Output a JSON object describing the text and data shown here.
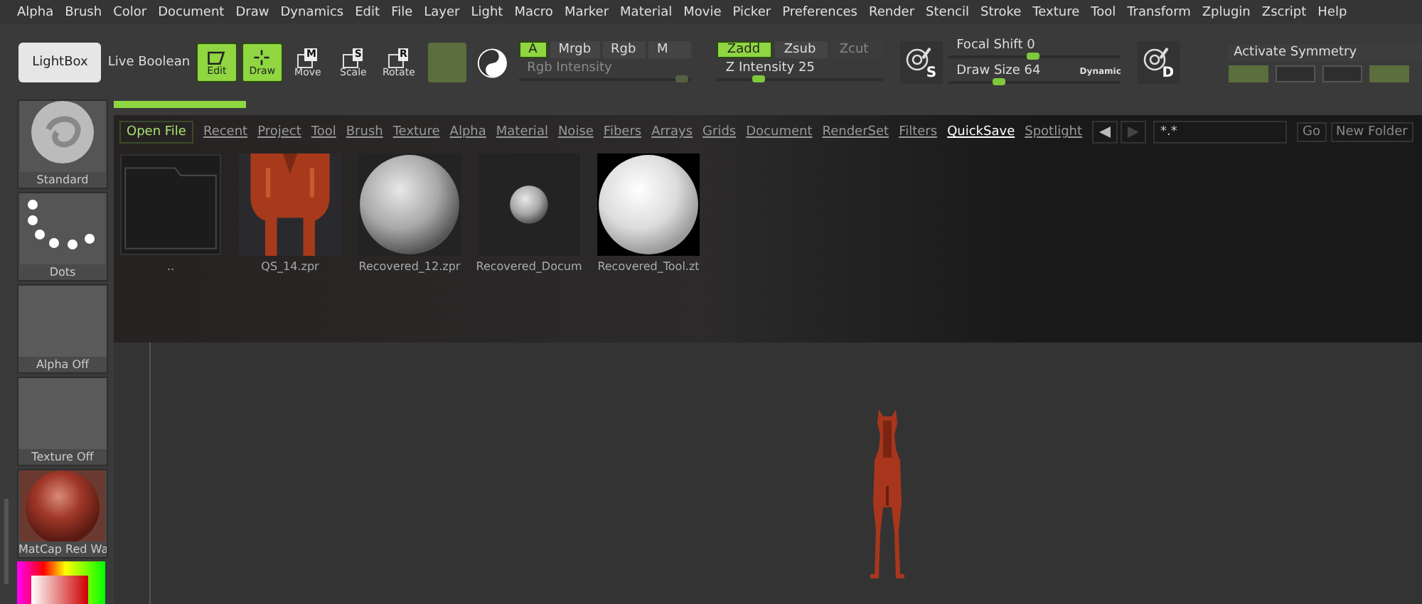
{
  "menu": [
    "Alpha",
    "Brush",
    "Color",
    "Document",
    "Draw",
    "Dynamics",
    "Edit",
    "File",
    "Layer",
    "Light",
    "Macro",
    "Marker",
    "Material",
    "Movie",
    "Picker",
    "Preferences",
    "Render",
    "Stencil",
    "Stroke",
    "Texture",
    "Tool",
    "Transform",
    "Zplugin",
    "Zscript",
    "Help"
  ],
  "toolbar": {
    "lightbox": "LightBox",
    "live_boolean": "Live Boolean",
    "tools": [
      {
        "label": "Edit",
        "kind": "edit",
        "selected": true
      },
      {
        "label": "Draw",
        "kind": "draw",
        "selected": true
      },
      {
        "label": "Move",
        "kind": "move",
        "key": "M",
        "selected": false
      },
      {
        "label": "Scale",
        "kind": "scale",
        "key": "S",
        "selected": false
      },
      {
        "label": "Rotate",
        "kind": "rotate",
        "key": "R",
        "selected": false
      }
    ],
    "color_modes": [
      {
        "label": "A",
        "selected": true
      },
      {
        "label": "Mrgb",
        "selected": false
      },
      {
        "label": "Rgb",
        "selected": false
      },
      {
        "label": "M",
        "selected": false
      }
    ],
    "rgb_intensity": {
      "label": "Rgb Intensity",
      "disabled": true,
      "level": 0.95
    },
    "z_modes": [
      {
        "label": "Zadd",
        "selected": true,
        "disabled": false
      },
      {
        "label": "Zsub",
        "selected": false,
        "disabled": false
      },
      {
        "label": "Zcut",
        "selected": false,
        "disabled": true
      }
    ],
    "z_intensity": {
      "label": "Z Intensity 25",
      "level": 0.25
    },
    "stroke_key": "S",
    "focal_shift": {
      "label": "Focal Shift 0",
      "level": 0.5
    },
    "draw_size": {
      "label": "Draw Size 64",
      "level": 0.3
    },
    "dynamic": "Dynamic",
    "alpha_key": "D",
    "symmetry": {
      "label": "Activate Symmetry"
    }
  },
  "progress": {
    "level": 1
  },
  "palette": [
    {
      "label": "Standard",
      "kind": "brush"
    },
    {
      "label": "Dots",
      "kind": "stroke"
    },
    {
      "label": "Alpha Off",
      "kind": "blank"
    },
    {
      "label": "Texture Off",
      "kind": "blank"
    },
    {
      "label": "MatCap Red Wa",
      "kind": "material"
    }
  ],
  "lightbox": {
    "open_file": "Open File",
    "tabs": [
      {
        "label": "Recent",
        "selected": false
      },
      {
        "label": "Project",
        "selected": false
      },
      {
        "label": "Tool",
        "selected": false
      },
      {
        "label": "Brush",
        "selected": false
      },
      {
        "label": "Texture",
        "selected": false
      },
      {
        "label": "Alpha",
        "selected": false
      },
      {
        "label": "Material",
        "selected": false
      },
      {
        "label": "Noise",
        "selected": false
      },
      {
        "label": "Fibers",
        "selected": false
      },
      {
        "label": "Arrays",
        "selected": false
      },
      {
        "label": "Grids",
        "selected": false
      },
      {
        "label": "Document",
        "selected": false
      },
      {
        "label": "RenderSet",
        "selected": false
      },
      {
        "label": "Filters",
        "selected": false
      },
      {
        "label": "QuickSave",
        "selected": true
      },
      {
        "label": "Spotlight",
        "selected": false
      }
    ],
    "path": "*.*",
    "go": "Go",
    "new_folder": "New Folder",
    "files": [
      {
        "name": "..",
        "kind": "folder"
      },
      {
        "name": "QS_14.zpr",
        "kind": "picture"
      },
      {
        "name": "Recovered_12.zpr",
        "kind": "sphere"
      },
      {
        "name": "Recovered_Docum",
        "kind": "small-sphere"
      },
      {
        "name": "Recovered_Tool.zt",
        "kind": "bright-sphere"
      }
    ]
  }
}
